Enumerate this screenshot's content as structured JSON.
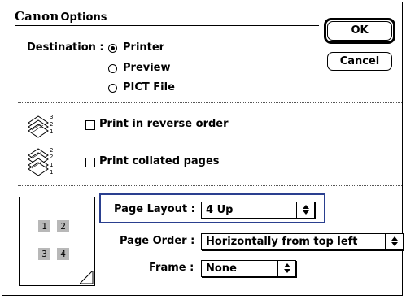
{
  "dialog": {
    "brand": "Canon",
    "title_rest": "Options",
    "ok_label": "OK",
    "cancel_label": "Cancel"
  },
  "destination": {
    "label": "Destination :",
    "options": [
      {
        "label": "Printer",
        "selected": true
      },
      {
        "label": "Preview",
        "selected": false
      },
      {
        "label": "PICT File",
        "selected": false
      }
    ]
  },
  "options": {
    "reverse_order": {
      "label": "Print in reverse order",
      "checked": false,
      "icon": "stacked-pages-icon",
      "stack_numbers": [
        "3",
        "2",
        "1"
      ]
    },
    "collated": {
      "label": "Print collated pages",
      "checked": false,
      "icon": "collated-pages-icon",
      "stack_numbers": [
        "2",
        "2",
        "1",
        "1"
      ]
    }
  },
  "layout": {
    "page_layout_label": "Page Layout :",
    "page_layout_value": "4 Up",
    "page_order_label": "Page Order :",
    "page_order_value": "Horizontally from top left",
    "frame_label": "Frame :",
    "frame_value": "None",
    "preview_cells": [
      "1",
      "2",
      "3",
      "4"
    ],
    "highlight_color": "#2a3f8f"
  }
}
